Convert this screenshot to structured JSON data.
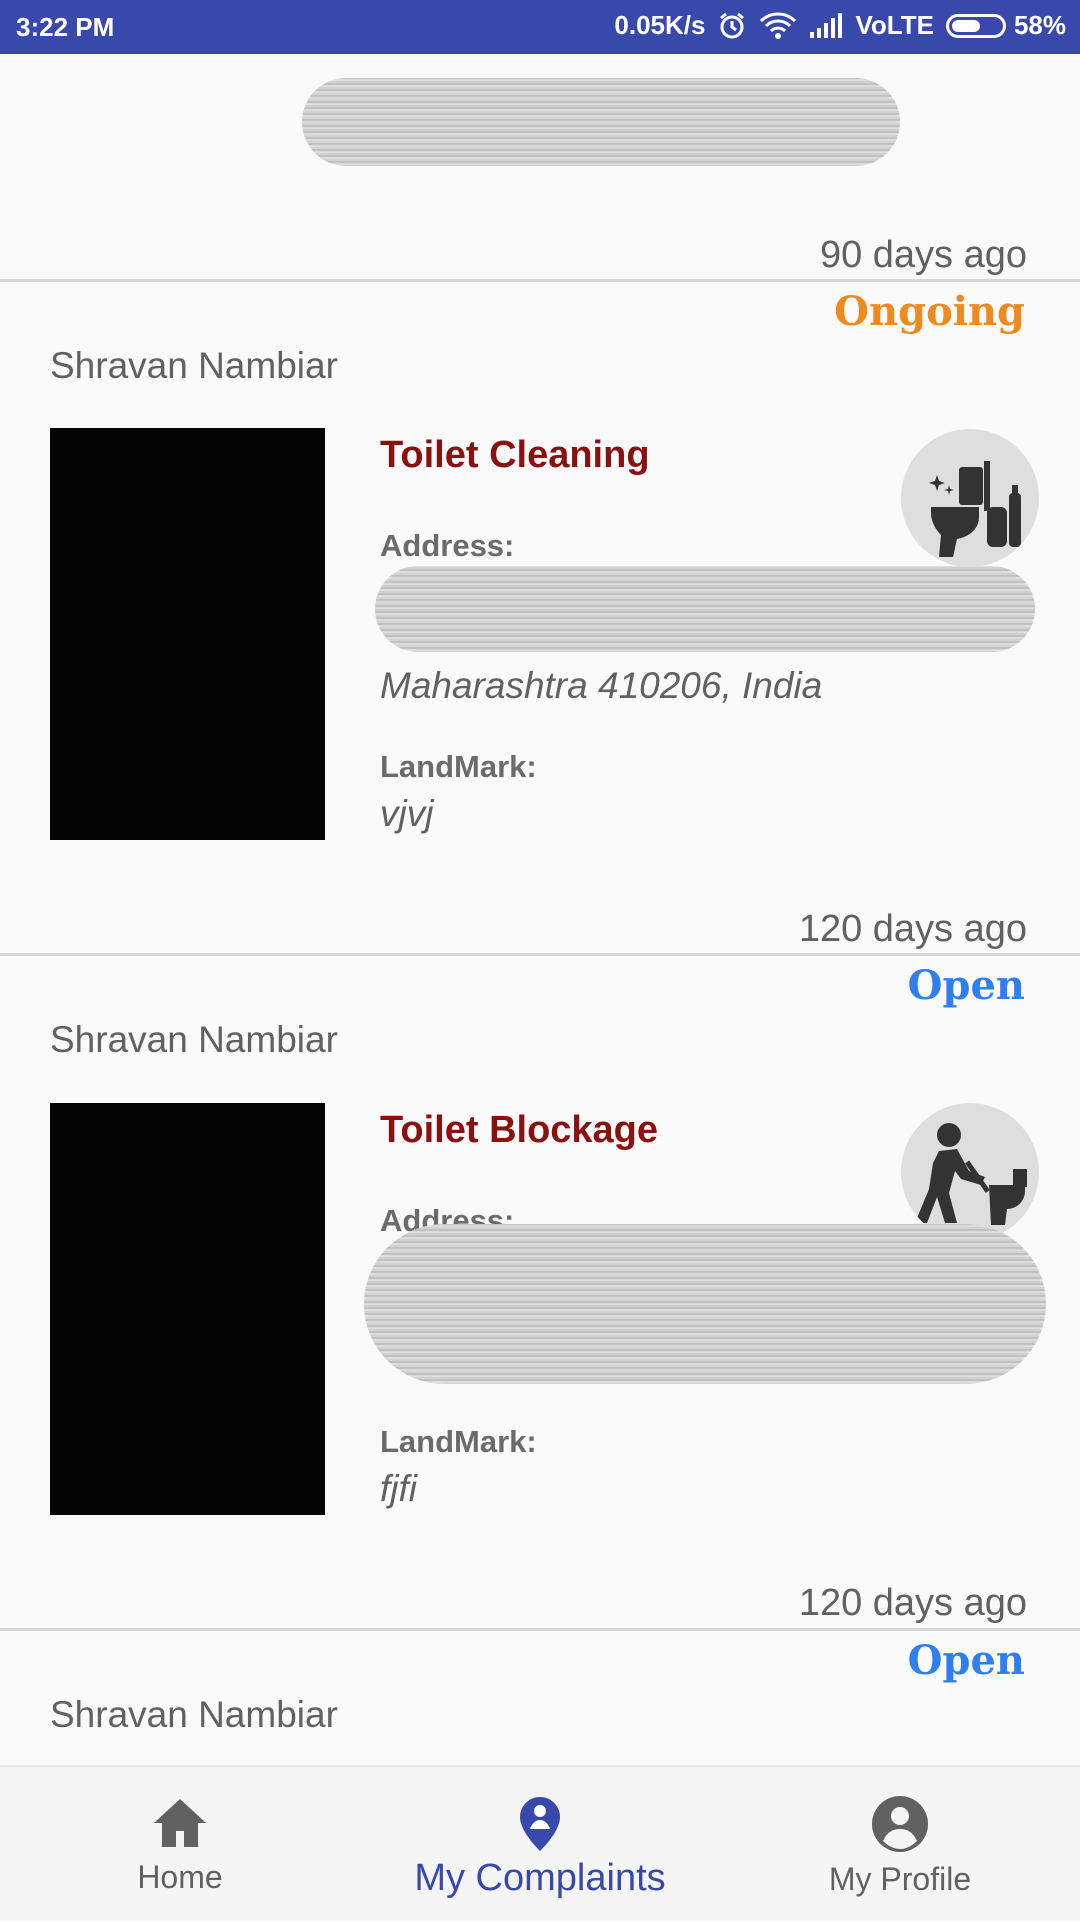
{
  "status_bar": {
    "time": "3:22 PM",
    "speed": "0.05K/s",
    "network": "VoLTE",
    "battery_percent": "58%",
    "battery_level": 0.58
  },
  "complaints": [
    {
      "time_ago": "90 days ago",
      "status": "Ongoing",
      "status_color": "#ee8a1e",
      "user": "Shravan Nambiar",
      "category": "Toilet Cleaning",
      "category_icon": "toilet-cleaning-icon",
      "address_label": "Address:",
      "address_visible": "Maharashtra 410206, India",
      "landmark_label": "LandMark:",
      "landmark": "vjvj"
    },
    {
      "time_ago": "120 days ago",
      "status": "Open",
      "status_color": "#2f7ff0",
      "user": "Shravan Nambiar",
      "category": "Toilet Blockage",
      "category_icon": "toilet-plunger-icon",
      "address_label": "Address:",
      "landmark_label": "LandMark:",
      "landmark": "fjfi"
    },
    {
      "time_ago": "120 days ago",
      "status": "Open",
      "status_color": "#2f7ff0",
      "user": "Shravan Nambiar"
    }
  ],
  "bottom_nav": {
    "items": [
      {
        "label": "Home",
        "icon": "home-icon"
      },
      {
        "label": "My Complaints",
        "icon": "location-pin-icon",
        "active": true
      },
      {
        "label": "My Profile",
        "icon": "account-circle-icon"
      }
    ],
    "active_color": "#3949ab"
  }
}
